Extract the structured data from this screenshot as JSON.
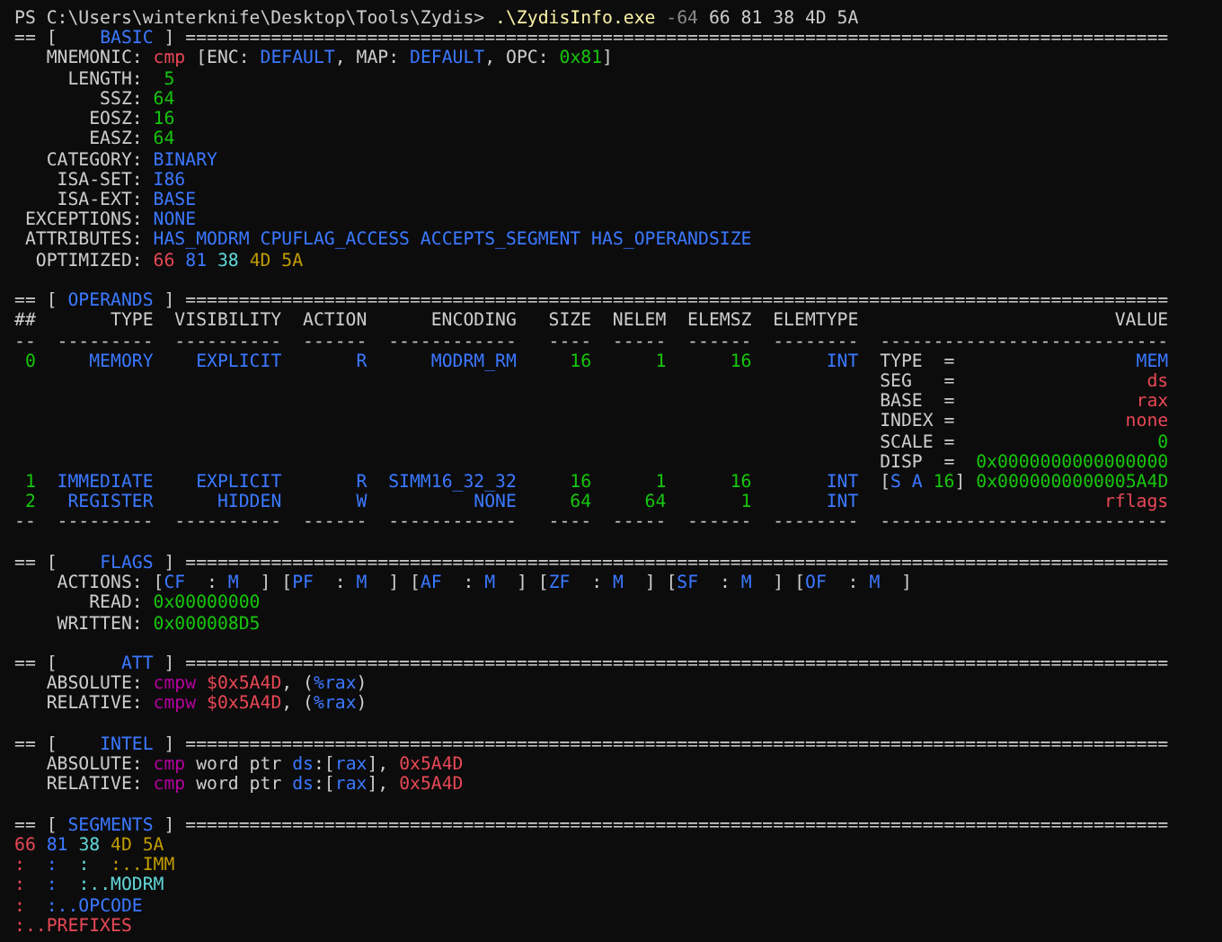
{
  "terminal": {
    "blocks": [
      {
        "lines": [
          {
            "kind": "plain",
            "segments": [
              {
                "text": "PS C:\\Users\\winterknife\\Desktop\\Tools\\Zydis> ",
                "color": "#cccccc"
              },
              {
                "text": ".\\ZydisInfo.exe ",
                "color": "#f9f1a5"
              },
              {
                "text": "-64 ",
                "color": "#8a8a8a"
              },
              {
                "text": "66 81 38 4D 5A",
                "color": "#cccccc"
              }
            ]
          },
          {
            "kind": "plain",
            "segments": [
              {
                "text": "== [ ",
                "color": "#cccccc"
              },
              {
                "text": "   BASIC",
                "color": "#3b78ff"
              },
              {
                "text": " ] ============================================================================================",
                "color": "#cccccc"
              }
            ]
          },
          {
            "kind": "plain",
            "segments": [
              {
                "text": "   MNEMONIC: ",
                "color": "#cccccc"
              },
              {
                "text": "cmp",
                "color": "#e74856"
              },
              {
                "text": " [ENC: ",
                "color": "#cccccc"
              },
              {
                "text": "DEFAULT",
                "color": "#3b78ff"
              },
              {
                "text": ", MAP: ",
                "color": "#cccccc"
              },
              {
                "text": "DEFAULT",
                "color": "#3b78ff"
              },
              {
                "text": ", OPC: ",
                "color": "#cccccc"
              },
              {
                "text": "0x81",
                "color": "#16c60c"
              },
              {
                "text": "]",
                "color": "#cccccc"
              }
            ]
          },
          {
            "kind": "plain",
            "segments": [
              {
                "text": "     LENGTH: ",
                "color": "#cccccc"
              },
              {
                "text": " 5",
                "color": "#16c60c"
              }
            ]
          },
          {
            "kind": "plain",
            "segments": [
              {
                "text": "        SSZ: ",
                "color": "#cccccc"
              },
              {
                "text": "64",
                "color": "#16c60c"
              }
            ]
          },
          {
            "kind": "plain",
            "segments": [
              {
                "text": "       EOSZ: ",
                "color": "#cccccc"
              },
              {
                "text": "16",
                "color": "#16c60c"
              }
            ]
          },
          {
            "kind": "plain",
            "segments": [
              {
                "text": "       EASZ: ",
                "color": "#cccccc"
              },
              {
                "text": "64",
                "color": "#16c60c"
              }
            ]
          },
          {
            "kind": "plain",
            "segments": [
              {
                "text": "   CATEGORY: ",
                "color": "#cccccc"
              },
              {
                "text": "BINARY",
                "color": "#3b78ff"
              }
            ]
          },
          {
            "kind": "plain",
            "segments": [
              {
                "text": "    ISA-SET: ",
                "color": "#cccccc"
              },
              {
                "text": "I86",
                "color": "#3b78ff"
              }
            ]
          },
          {
            "kind": "plain",
            "segments": [
              {
                "text": "    ISA-EXT: ",
                "color": "#cccccc"
              },
              {
                "text": "BASE",
                "color": "#3b78ff"
              }
            ]
          },
          {
            "kind": "plain",
            "segments": [
              {
                "text": " EXCEPTIONS: ",
                "color": "#cccccc"
              },
              {
                "text": "NONE",
                "color": "#3b78ff"
              }
            ]
          },
          {
            "kind": "plain",
            "segments": [
              {
                "text": " ATTRIBUTES: ",
                "color": "#cccccc"
              },
              {
                "text": "HAS_MODRM CPUFLAG_ACCESS ACCEPTS_SEGMENT HAS_OPERANDSIZE",
                "color": "#3b78ff"
              }
            ]
          },
          {
            "kind": "plain",
            "segments": [
              {
                "text": "  OPTIMIZED: ",
                "color": "#cccccc"
              },
              {
                "text": "66 ",
                "color": "#e74856"
              },
              {
                "text": "81 ",
                "color": "#3b78ff"
              },
              {
                "text": "38 ",
                "color": "#61d6d6"
              },
              {
                "text": "4D 5A",
                "color": "#c19c00"
              }
            ]
          }
        ]
      },
      {
        "lines": [
          {
            "kind": "plain",
            "segments": [
              {
                "text": "== [ ",
                "color": "#cccccc"
              },
              {
                "text": "OPERANDS",
                "color": "#3b78ff"
              },
              {
                "text": " ] ============================================================================================",
                "color": "#cccccc"
              }
            ]
          },
          {
            "kind": "plain",
            "segments": [
              {
                "text": "##       TYPE  VISIBILITY  ACTION      ENCODING   SIZE  NELEM  ELEMSZ  ELEMTYPE                        VALUE",
                "color": "#cccccc"
              }
            ]
          },
          {
            "kind": "plain",
            "segments": [
              {
                "text": "--  ---------  ----------  ------  ------------   ----  -----  ------  --------  ---------------------------",
                "color": "#cccccc"
              }
            ]
          },
          {
            "kind": "plain",
            "segments": [
              {
                "text": " 0",
                "color": "#16c60c"
              },
              {
                "text": "     MEMORY",
                "color": "#3b78ff"
              },
              {
                "text": "    EXPLICIT",
                "color": "#3b78ff"
              },
              {
                "text": "       R",
                "color": "#3b78ff"
              },
              {
                "text": "      MODRM_RM",
                "color": "#3b78ff"
              },
              {
                "text": "     16",
                "color": "#16c60c"
              },
              {
                "text": "      1",
                "color": "#16c60c"
              },
              {
                "text": "      16",
                "color": "#16c60c"
              },
              {
                "text": "       INT",
                "color": "#3b78ff"
              },
              {
                "text": "  TYPE  =",
                "color": "#cccccc"
              },
              {
                "text": "                 MEM",
                "color": "#3b78ff"
              }
            ]
          },
          {
            "kind": "detail",
            "segments": [
              {
                "text": "SEG   =",
                "color": "#cccccc"
              },
              {
                "text": "                  ds",
                "color": "#e74856"
              }
            ]
          },
          {
            "kind": "detail",
            "segments": [
              {
                "text": "BASE  =",
                "color": "#cccccc"
              },
              {
                "text": "                 rax",
                "color": "#e74856"
              }
            ]
          },
          {
            "kind": "detail",
            "segments": [
              {
                "text": "INDEX =",
                "color": "#cccccc"
              },
              {
                "text": "                none",
                "color": "#e74856"
              }
            ]
          },
          {
            "kind": "detail",
            "segments": [
              {
                "text": "SCALE =",
                "color": "#cccccc"
              },
              {
                "text": "                   0",
                "color": "#16c60c"
              }
            ]
          },
          {
            "kind": "detail",
            "segments": [
              {
                "text": "DISP  =",
                "color": "#cccccc"
              },
              {
                "text": "  0x0000000000000000",
                "color": "#16c60c"
              }
            ]
          },
          {
            "kind": "plain",
            "segments": [
              {
                "text": " 1",
                "color": "#16c60c"
              },
              {
                "text": "  IMMEDIATE",
                "color": "#3b78ff"
              },
              {
                "text": "    EXPLICIT",
                "color": "#3b78ff"
              },
              {
                "text": "       R",
                "color": "#3b78ff"
              },
              {
                "text": "  SIMM16_32_32",
                "color": "#3b78ff"
              },
              {
                "text": "     16",
                "color": "#16c60c"
              },
              {
                "text": "      1",
                "color": "#16c60c"
              },
              {
                "text": "      16",
                "color": "#16c60c"
              },
              {
                "text": "       INT",
                "color": "#3b78ff"
              },
              {
                "text": "  [",
                "color": "#cccccc"
              },
              {
                "text": "S A",
                "color": "#3b78ff"
              },
              {
                "text": " 16",
                "color": "#16c60c"
              },
              {
                "text": "] ",
                "color": "#cccccc"
              },
              {
                "text": "0x0000000000005A4D",
                "color": "#16c60c"
              }
            ]
          },
          {
            "kind": "plain",
            "segments": [
              {
                "text": " 2",
                "color": "#16c60c"
              },
              {
                "text": "   REGISTER",
                "color": "#3b78ff"
              },
              {
                "text": "      HIDDEN",
                "color": "#3b78ff"
              },
              {
                "text": "       W",
                "color": "#3b78ff"
              },
              {
                "text": "          NONE",
                "color": "#3b78ff"
              },
              {
                "text": "     64",
                "color": "#16c60c"
              },
              {
                "text": "     64",
                "color": "#16c60c"
              },
              {
                "text": "       1",
                "color": "#16c60c"
              },
              {
                "text": "       INT",
                "color": "#3b78ff"
              },
              {
                "text": "                       rflags",
                "color": "#e74856"
              }
            ]
          },
          {
            "kind": "plain",
            "segments": [
              {
                "text": "--  ---------  ----------  ------  ------------   ----  -----  ------  --------  ---------------------------",
                "color": "#cccccc"
              }
            ]
          }
        ]
      },
      {
        "lines": [
          {
            "kind": "plain",
            "segments": [
              {
                "text": "== [ ",
                "color": "#cccccc"
              },
              {
                "text": "   FLAGS",
                "color": "#3b78ff"
              },
              {
                "text": " ] ============================================================================================",
                "color": "#cccccc"
              }
            ]
          },
          {
            "kind": "plain",
            "segments": [
              {
                "text": "    ACTIONS: [",
                "color": "#cccccc"
              },
              {
                "text": "CF",
                "color": "#3b78ff"
              },
              {
                "text": "  : ",
                "color": "#cccccc"
              },
              {
                "text": "M",
                "color": "#3b78ff"
              },
              {
                "text": "  ] [",
                "color": "#cccccc"
              },
              {
                "text": "PF",
                "color": "#3b78ff"
              },
              {
                "text": "  : ",
                "color": "#cccccc"
              },
              {
                "text": "M",
                "color": "#3b78ff"
              },
              {
                "text": "  ] [",
                "color": "#cccccc"
              },
              {
                "text": "AF",
                "color": "#3b78ff"
              },
              {
                "text": "  : ",
                "color": "#cccccc"
              },
              {
                "text": "M",
                "color": "#3b78ff"
              },
              {
                "text": "  ] [",
                "color": "#cccccc"
              },
              {
                "text": "ZF",
                "color": "#3b78ff"
              },
              {
                "text": "  : ",
                "color": "#cccccc"
              },
              {
                "text": "M",
                "color": "#3b78ff"
              },
              {
                "text": "  ] [",
                "color": "#cccccc"
              },
              {
                "text": "SF",
                "color": "#3b78ff"
              },
              {
                "text": "  : ",
                "color": "#cccccc"
              },
              {
                "text": "M",
                "color": "#3b78ff"
              },
              {
                "text": "  ] [",
                "color": "#cccccc"
              },
              {
                "text": "OF",
                "color": "#3b78ff"
              },
              {
                "text": "  : ",
                "color": "#cccccc"
              },
              {
                "text": "M",
                "color": "#3b78ff"
              },
              {
                "text": "  ]",
                "color": "#cccccc"
              }
            ]
          },
          {
            "kind": "plain",
            "segments": [
              {
                "text": "       READ: ",
                "color": "#cccccc"
              },
              {
                "text": "0x00000000",
                "color": "#16c60c"
              }
            ]
          },
          {
            "kind": "plain",
            "segments": [
              {
                "text": "    WRITTEN: ",
                "color": "#cccccc"
              },
              {
                "text": "0x000008D5",
                "color": "#16c60c"
              }
            ]
          }
        ]
      },
      {
        "lines": [
          {
            "kind": "plain",
            "segments": [
              {
                "text": "== [ ",
                "color": "#cccccc"
              },
              {
                "text": "     ATT",
                "color": "#3b78ff"
              },
              {
                "text": " ] ============================================================================================",
                "color": "#cccccc"
              }
            ]
          },
          {
            "kind": "plain",
            "segments": [
              {
                "text": "   ABSOLUTE: ",
                "color": "#cccccc"
              },
              {
                "text": "cmpw ",
                "color": "#b4009e"
              },
              {
                "text": "$0x5A4D",
                "color": "#e74856"
              },
              {
                "text": ", (",
                "color": "#cccccc"
              },
              {
                "text": "%rax",
                "color": "#3b78ff"
              },
              {
                "text": ")",
                "color": "#cccccc"
              }
            ]
          },
          {
            "kind": "plain",
            "segments": [
              {
                "text": "   RELATIVE: ",
                "color": "#cccccc"
              },
              {
                "text": "cmpw ",
                "color": "#b4009e"
              },
              {
                "text": "$0x5A4D",
                "color": "#e74856"
              },
              {
                "text": ", (",
                "color": "#cccccc"
              },
              {
                "text": "%rax",
                "color": "#3b78ff"
              },
              {
                "text": ")",
                "color": "#cccccc"
              }
            ]
          }
        ]
      },
      {
        "lines": [
          {
            "kind": "plain",
            "segments": [
              {
                "text": "== [ ",
                "color": "#cccccc"
              },
              {
                "text": "   INTEL",
                "color": "#3b78ff"
              },
              {
                "text": " ] ============================================================================================",
                "color": "#cccccc"
              }
            ]
          },
          {
            "kind": "plain",
            "segments": [
              {
                "text": "   ABSOLUTE: ",
                "color": "#cccccc"
              },
              {
                "text": "cmp",
                "color": "#b4009e"
              },
              {
                "text": " word ptr ",
                "color": "#cccccc"
              },
              {
                "text": "ds",
                "color": "#3b78ff"
              },
              {
                "text": ":[",
                "color": "#cccccc"
              },
              {
                "text": "rax",
                "color": "#3b78ff"
              },
              {
                "text": "], ",
                "color": "#cccccc"
              },
              {
                "text": "0x5A4D",
                "color": "#e74856"
              }
            ]
          },
          {
            "kind": "plain",
            "segments": [
              {
                "text": "   RELATIVE: ",
                "color": "#cccccc"
              },
              {
                "text": "cmp",
                "color": "#b4009e"
              },
              {
                "text": " word ptr ",
                "color": "#cccccc"
              },
              {
                "text": "ds",
                "color": "#3b78ff"
              },
              {
                "text": ":[",
                "color": "#cccccc"
              },
              {
                "text": "rax",
                "color": "#3b78ff"
              },
              {
                "text": "], ",
                "color": "#cccccc"
              },
              {
                "text": "0x5A4D",
                "color": "#e74856"
              }
            ]
          }
        ]
      },
      {
        "lines": [
          {
            "kind": "plain",
            "segments": [
              {
                "text": "== [ ",
                "color": "#cccccc"
              },
              {
                "text": "SEGMENTS",
                "color": "#3b78ff"
              },
              {
                "text": " ] ============================================================================================",
                "color": "#cccccc"
              }
            ]
          },
          {
            "kind": "plain",
            "segments": [
              {
                "text": "66 ",
                "color": "#e74856"
              },
              {
                "text": "81 ",
                "color": "#3b78ff"
              },
              {
                "text": "38 ",
                "color": "#61d6d6"
              },
              {
                "text": "4D 5A",
                "color": "#c19c00"
              }
            ]
          },
          {
            "kind": "plain",
            "segments": [
              {
                "text": ":  ",
                "color": "#e74856"
              },
              {
                "text": ":  ",
                "color": "#3b78ff"
              },
              {
                "text": ":  ",
                "color": "#61d6d6"
              },
              {
                "text": ":..IMM",
                "color": "#c19c00"
              }
            ]
          },
          {
            "kind": "plain",
            "segments": [
              {
                "text": ":  ",
                "color": "#e74856"
              },
              {
                "text": ":  ",
                "color": "#3b78ff"
              },
              {
                "text": ":..MODRM",
                "color": "#61d6d6"
              }
            ]
          },
          {
            "kind": "plain",
            "segments": [
              {
                "text": ":  ",
                "color": "#e74856"
              },
              {
                "text": ":..OPCODE",
                "color": "#3b78ff"
              }
            ]
          },
          {
            "kind": "plain",
            "segments": [
              {
                "text": ":..PREFIXES",
                "color": "#e74856"
              }
            ]
          }
        ]
      }
    ]
  }
}
